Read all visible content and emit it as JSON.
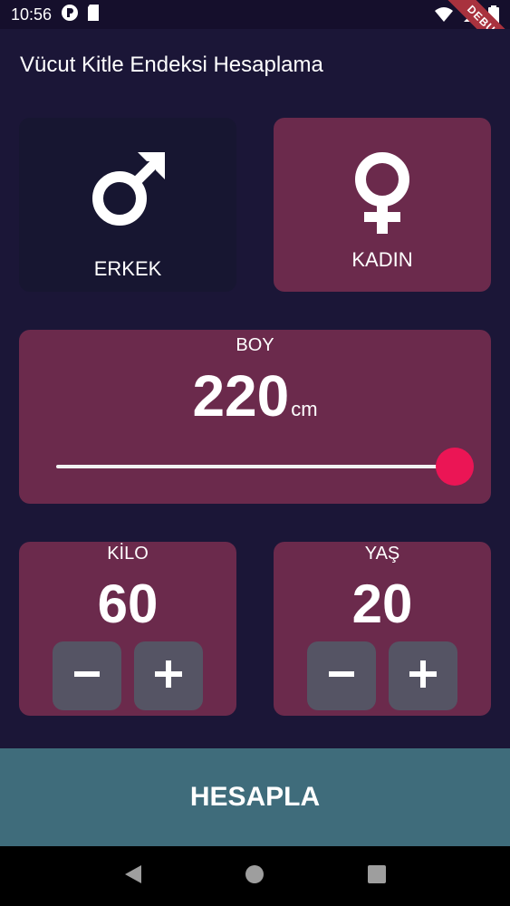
{
  "status_bar": {
    "time": "10:56",
    "icons_left": [
      "vpn-icon",
      "sd-card-icon"
    ],
    "icons_right": [
      "wifi-icon",
      "signal-icon",
      "battery-icon"
    ],
    "debug_banner": "DEBUG"
  },
  "app_bar": {
    "title": "Vücut Kitle Endeksi Hesaplama"
  },
  "gender": {
    "male_label": "ERKEK",
    "female_label": "KADIN",
    "male_icon": "male-symbol-icon",
    "female_icon": "female-symbol-icon"
  },
  "height": {
    "label": "BOY",
    "value": "220",
    "unit": "cm",
    "slider_fraction": 1.0
  },
  "weight": {
    "label": "KİLO",
    "value": "60"
  },
  "age": {
    "label": "YAŞ",
    "value": "20"
  },
  "stepper": {
    "minus_icon": "minus-icon",
    "plus_icon": "plus-icon"
  },
  "calculate_button": {
    "label": "HESAPLA"
  },
  "colors": {
    "background": "#1b1637",
    "active_card": "#6b2a4c",
    "inactive_card": "#171631",
    "accent": "#eb1555",
    "button": "#3f6c7b",
    "stepper": "#555464"
  }
}
